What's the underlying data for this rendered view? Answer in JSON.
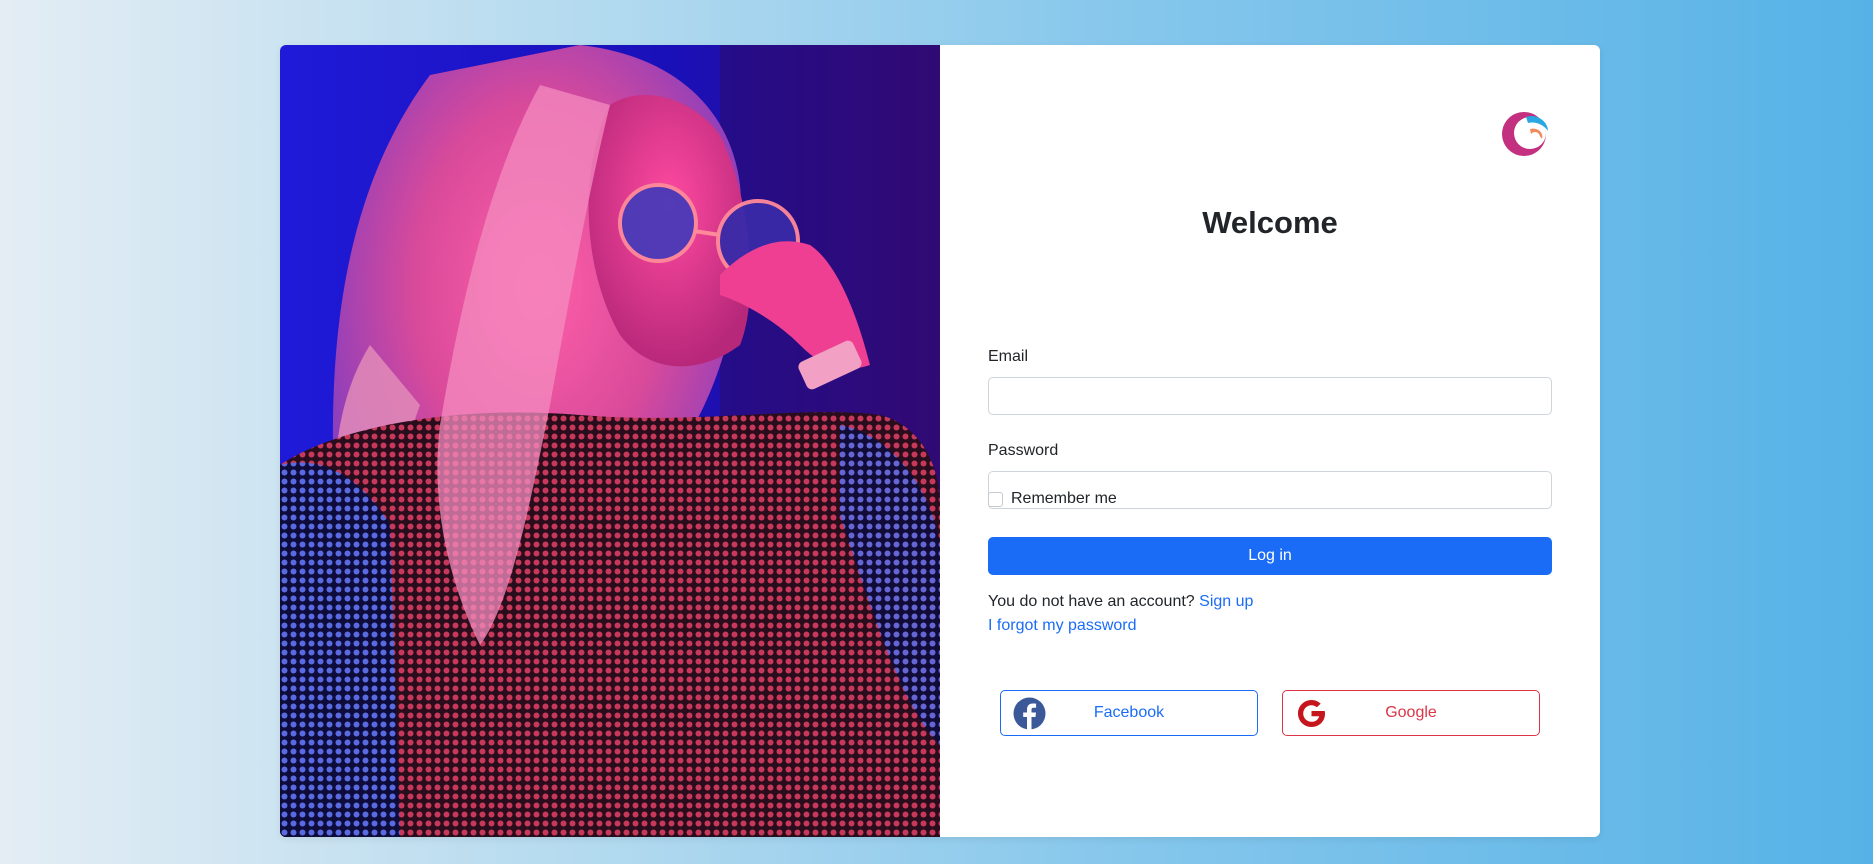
{
  "page": {
    "title": "Welcome"
  },
  "form": {
    "email_label": "Email",
    "email_value": "",
    "password_label": "Password",
    "password_value": "",
    "remember_label": "Remember me",
    "remember_checked": false,
    "login_label": "Log in",
    "no_account_text": "You do not have an account?",
    "signup_link": "Sign up",
    "forgot_link": "I forgot my password"
  },
  "social": {
    "facebook_label": "Facebook",
    "google_label": "Google"
  },
  "icons": {
    "logo": "brand-logo-icon",
    "facebook": "facebook-icon",
    "google": "google-icon"
  },
  "colors": {
    "primary": "#1a6cf6",
    "danger": "#dc3545",
    "facebook_brand": "#3b5998",
    "google_brand": "#c4161c",
    "background_start": "#e4edf4",
    "background_end": "#56b2e6"
  }
}
